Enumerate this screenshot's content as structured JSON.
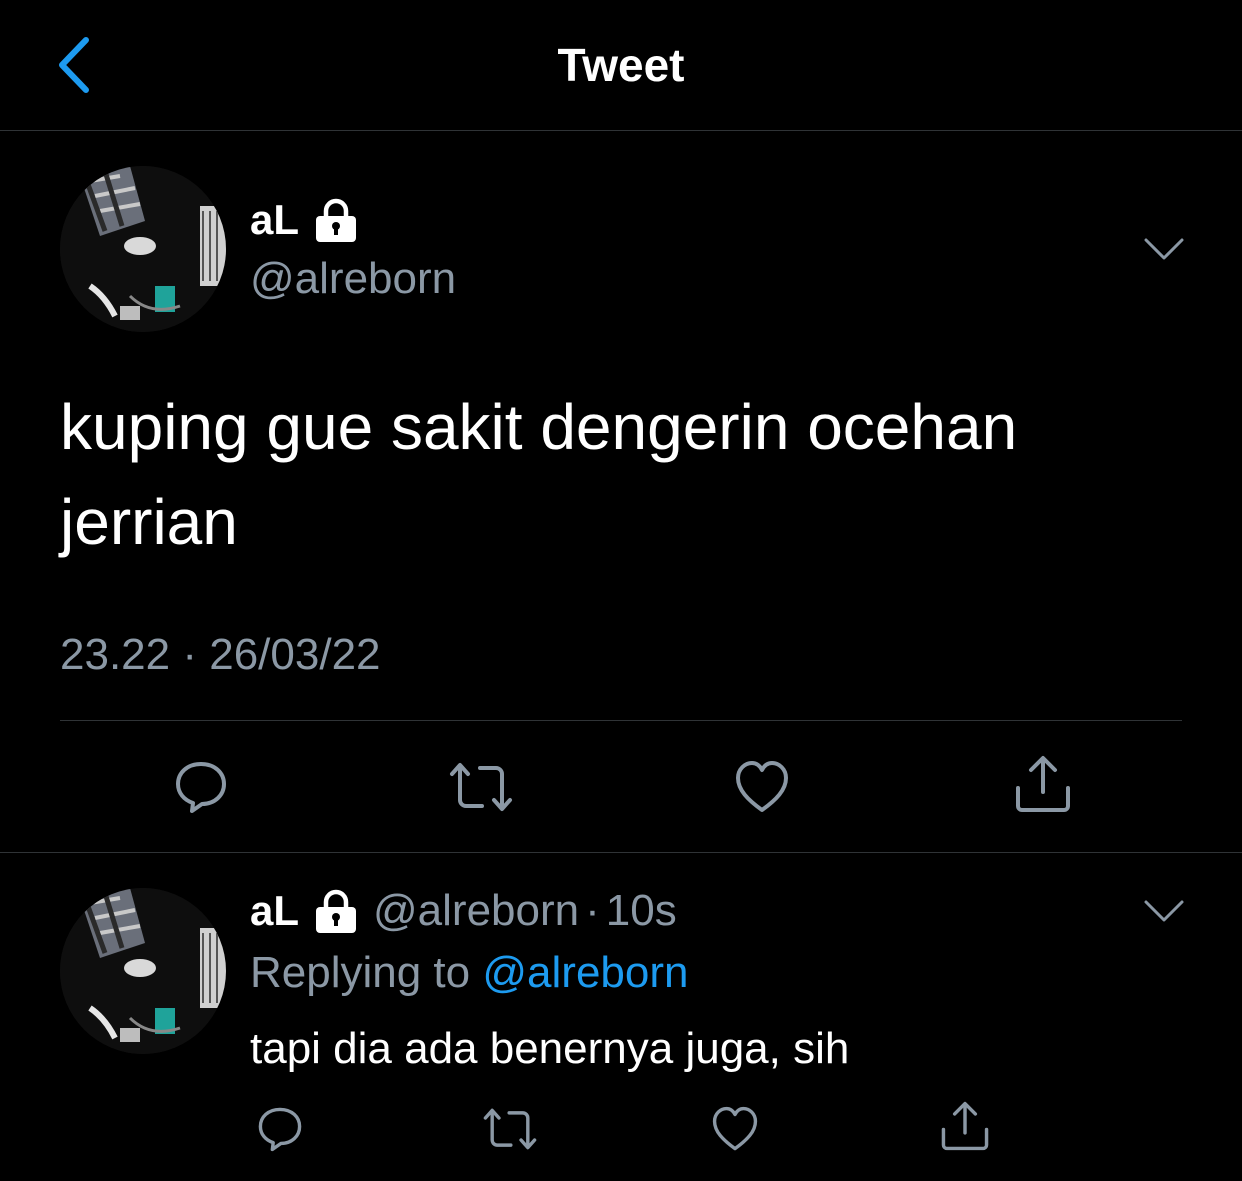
{
  "header": {
    "title": "Tweet",
    "back_icon": "chevron-left-icon"
  },
  "colors": {
    "background": "#000000",
    "text": "#ffffff",
    "secondary_text": "#8b98a5",
    "accent": "#1d9bf0",
    "divider": "#2f3336"
  },
  "tweet": {
    "display_name": "aL",
    "protected_icon": "lock-icon",
    "handle": "@alreborn",
    "text": "kuping gue sakit dengerin ocehan jerrian",
    "time": "23.22",
    "separator": "·",
    "date": "26/03/22",
    "actions": [
      "reply-icon",
      "retweet-icon",
      "like-icon",
      "share-icon"
    ]
  },
  "reply": {
    "display_name": "aL",
    "protected_icon": "lock-icon",
    "handle": "@alreborn",
    "separator": "·",
    "time_ago": "10s",
    "replying_prefix": "Replying to",
    "replying_to": "@alreborn",
    "text": "tapi dia ada benernya juga, sih",
    "actions": [
      "reply-icon",
      "retweet-icon",
      "like-icon",
      "share-icon"
    ]
  }
}
